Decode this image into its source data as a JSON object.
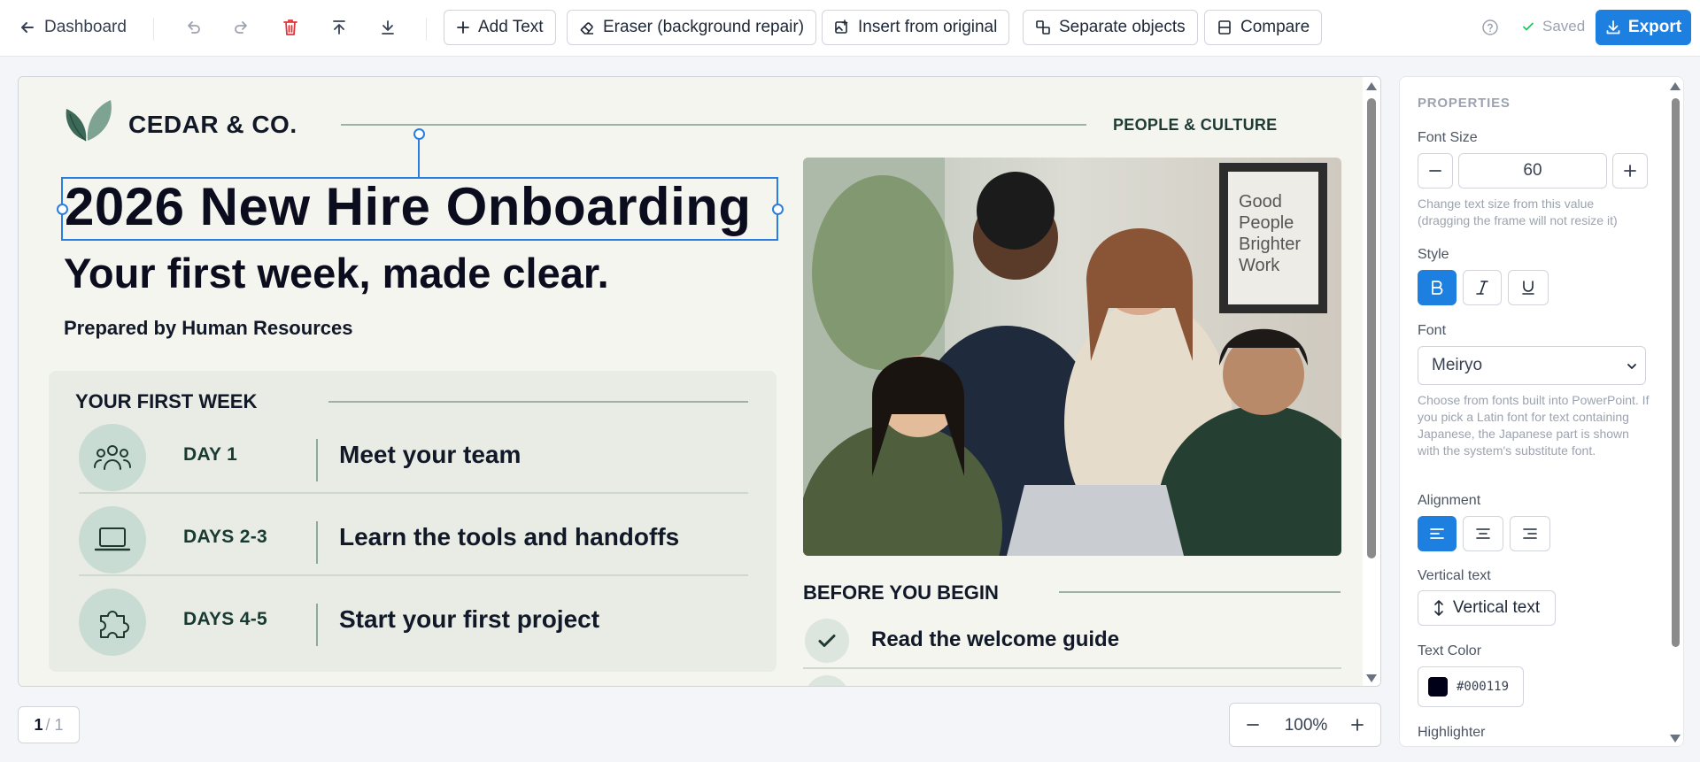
{
  "toolbar": {
    "back_label": "Dashboard",
    "add_text": "Add Text",
    "eraser": "Eraser (background repair)",
    "insert_original": "Insert from original",
    "separate": "Separate objects",
    "compare": "Compare",
    "saved": "Saved",
    "export": "Export"
  },
  "slide": {
    "brand": "CEDAR & CO.",
    "department": "PEOPLE & CULTURE",
    "title": "2026 New Hire Onboarding",
    "subtitle": "Your first week, made clear.",
    "prepared_by": "Prepared by Human Resources",
    "week": {
      "heading": "YOUR FIRST WEEK",
      "rows": [
        {
          "day": "DAY 1",
          "task": "Meet your team",
          "icon": "team-icon"
        },
        {
          "day": "DAYS 2-3",
          "task": "Learn the tools and handoffs",
          "icon": "laptop-icon"
        },
        {
          "day": "DAYS 4-5",
          "task": "Start your first project",
          "icon": "puzzle-icon"
        }
      ]
    },
    "photo": {
      "poster_text": [
        "Good",
        "People",
        "Brighter",
        "Work"
      ]
    },
    "before": {
      "heading": "BEFORE YOU BEGIN",
      "items": [
        "Read the welcome guide"
      ]
    }
  },
  "footer": {
    "page_current": "1",
    "page_total": "/ 1",
    "zoom": "100%"
  },
  "panel": {
    "title": "PROPERTIES",
    "font_size_label": "Font Size",
    "font_size_value": "60",
    "font_size_help": "Change text size from this value (dragging the frame will not resize it)",
    "style_label": "Style",
    "font_label": "Font",
    "font_value": "Meiryo",
    "font_help": "Choose from fonts built into PowerPoint. If you pick a Latin font for text containing Japanese, the Japanese part is shown with the system's substitute font.",
    "alignment_label": "Alignment",
    "vertical_label": "Vertical text",
    "vertical_button": "Vertical text",
    "color_label": "Text Color",
    "color_value": "#000119",
    "highlighter_label": "Highlighter"
  },
  "colors": {
    "accent": "#1d7fe0",
    "danger": "#e0353b",
    "saved": "#22c55e"
  }
}
